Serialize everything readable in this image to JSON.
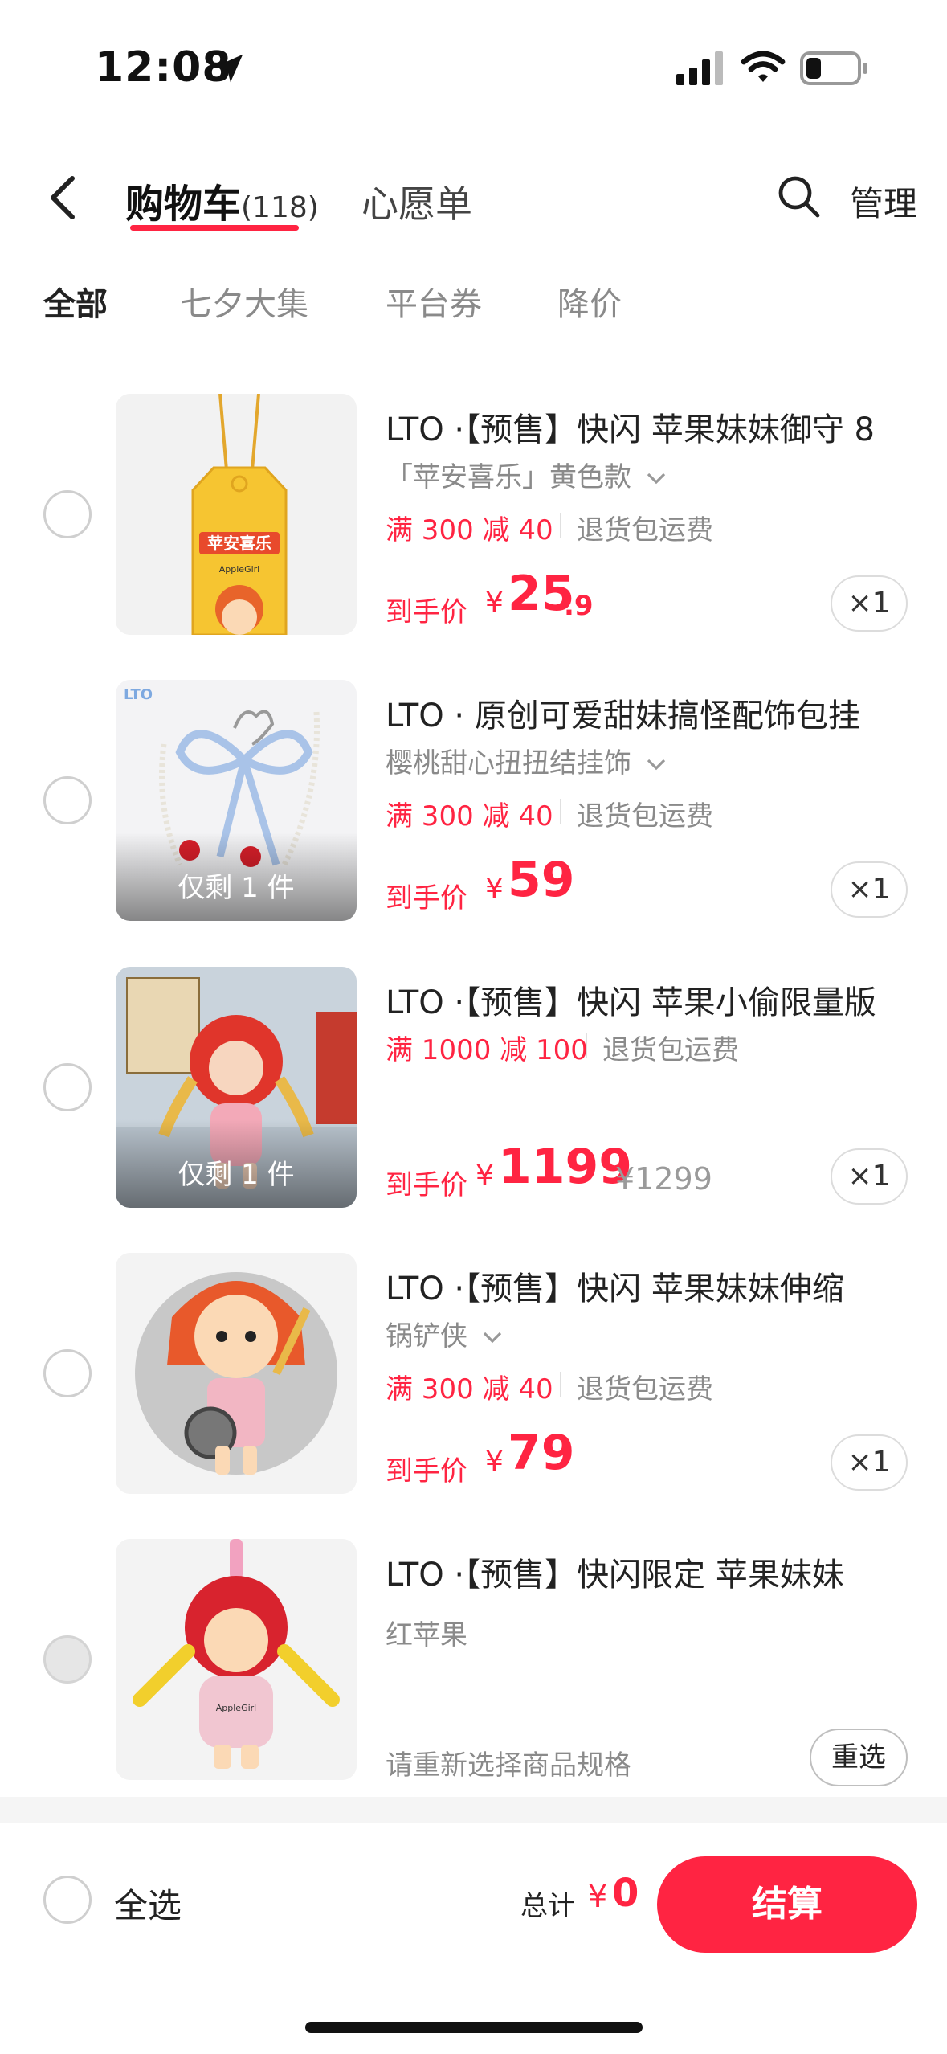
{
  "status_bar": {
    "time": "12:08"
  },
  "header": {
    "cart_tab": "购物车",
    "cart_count": "(118)",
    "wishlist_tab": "心愿单",
    "manage": "管理"
  },
  "filters": [
    "全部",
    "七夕大集",
    "平台券",
    "降价"
  ],
  "items": [
    {
      "title": "LTO ·【预售】快闪 苹果妹妹御守 8",
      "spec": "「苹安喜乐」黄色款",
      "promo": "满 300 减 40",
      "free_return": "退货包运费",
      "price_label": "到手价",
      "currency": "¥",
      "price_int": "25",
      "price_dec": ".9",
      "qty": "×1"
    },
    {
      "title": "LTO · 原创可爱甜妹搞怪配饰包挂",
      "spec": "樱桃甜心扭扭结挂饰",
      "stock": "仅剩 1 件",
      "promo": "满 300 减 40",
      "free_return": "退货包运费",
      "price_label": "到手价",
      "currency": "¥",
      "price_int": "59",
      "qty": "×1"
    },
    {
      "title": "LTO ·【预售】快闪 苹果小偷限量版",
      "stock": "仅剩 1 件",
      "promo": "满 1000 减 100",
      "free_return": "退货包运费",
      "price_label": "到手价",
      "currency": "¥",
      "price_int": "1199",
      "original_price": "¥1299",
      "qty": "×1"
    },
    {
      "title": "LTO ·【预售】快闪 苹果妹妹伸缩",
      "spec": "锅铲侠",
      "promo": "满 300 减 40",
      "free_return": "退货包运费",
      "price_label": "到手价",
      "currency": "¥",
      "price_int": "79",
      "qty": "×1"
    },
    {
      "title": "LTO ·【预售】快闪限定 苹果妹妹",
      "spec": "红苹果",
      "hint": "请重新选择商品规格",
      "reselect": "重选"
    }
  ],
  "image_text": {
    "omamori": "苹安喜乐",
    "brand_small": "AppleGirl",
    "lto_tag": "LTO"
  },
  "bottom_bar": {
    "select_all": "全选",
    "total_label": "总计",
    "currency": "¥",
    "total_value": "0",
    "checkout": "结算"
  },
  "colors": {
    "accent": "#ff2442",
    "muted": "#8a8a8a"
  }
}
